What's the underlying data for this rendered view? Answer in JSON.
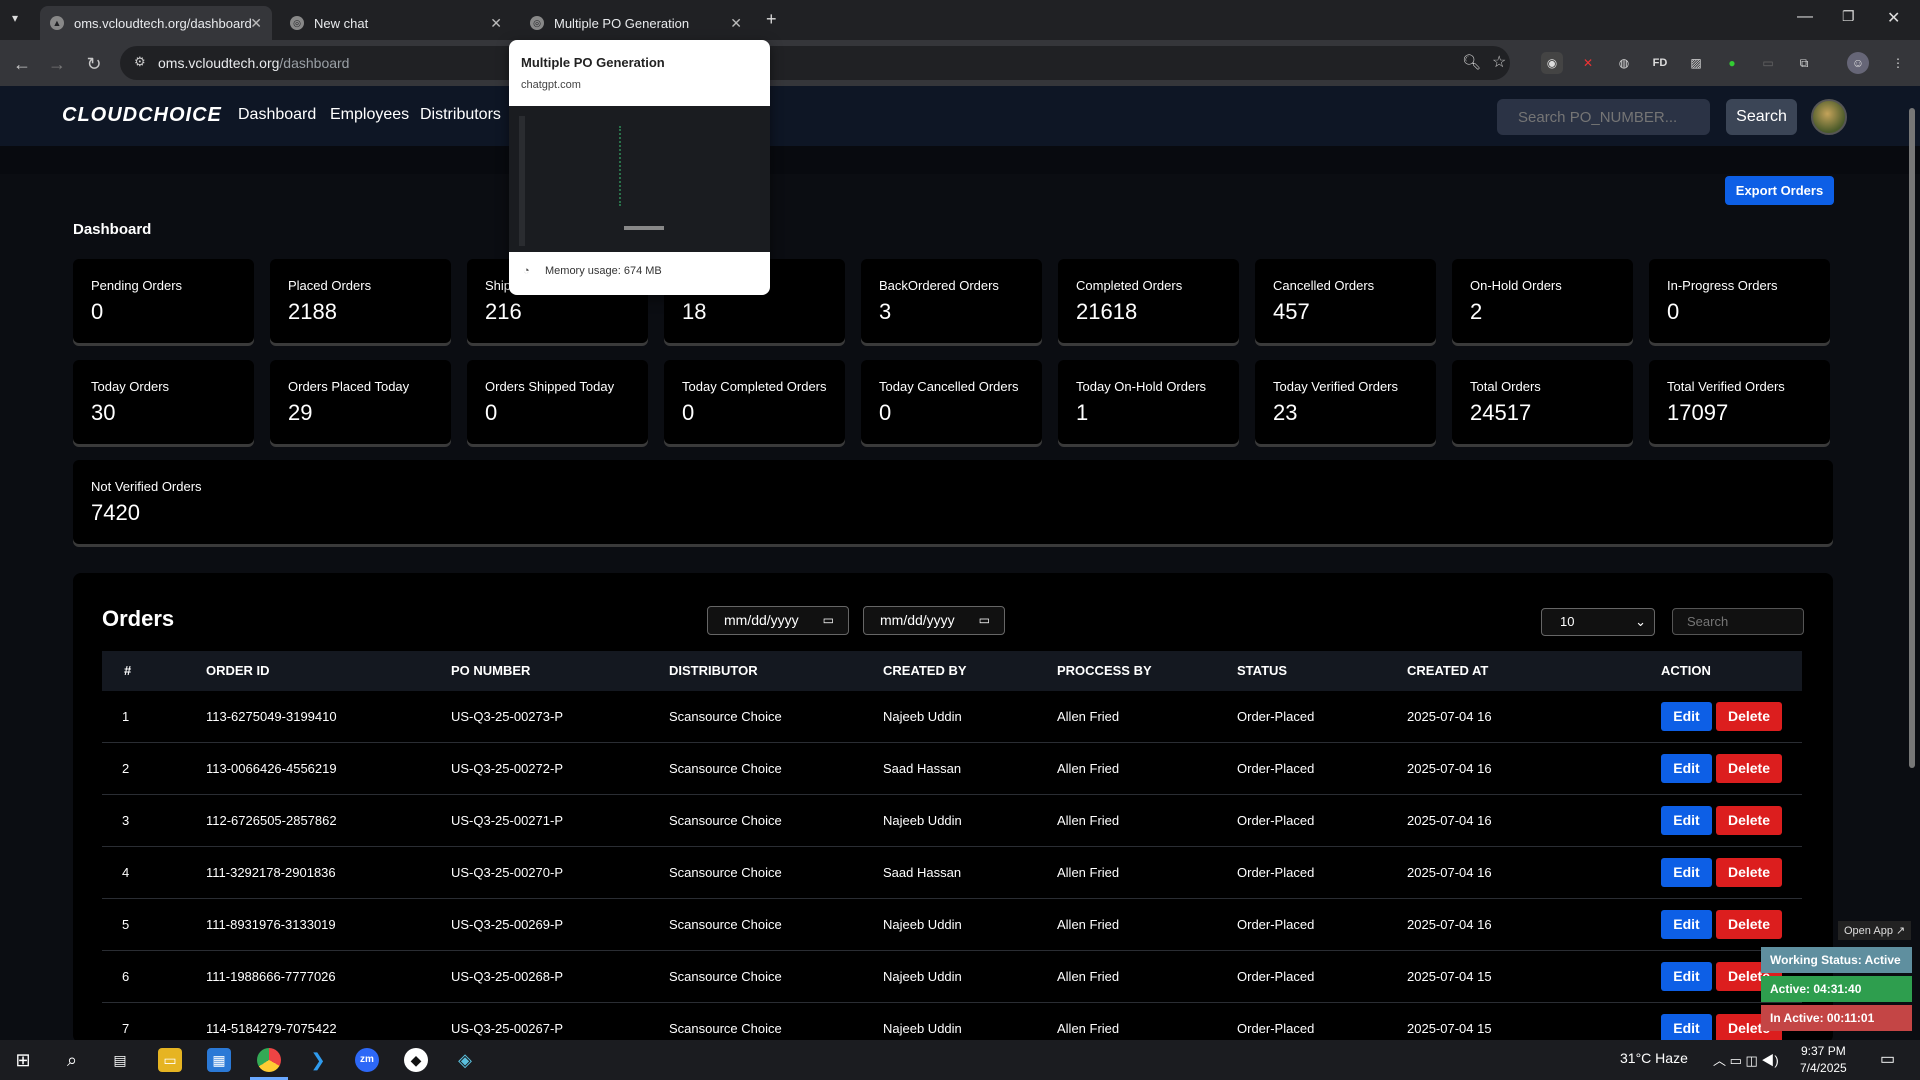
{
  "browser": {
    "tabs": [
      {
        "title": "oms.vcloudtech.org/dashboard"
      },
      {
        "title": "New chat"
      },
      {
        "title": "Multiple PO Generation"
      }
    ],
    "url_host": "oms.vcloudtech.org",
    "url_path": "/dashboard",
    "hover_card": {
      "title": "Multiple PO Generation",
      "domain": "chatgpt.com",
      "memory": "Memory usage: 674 MB"
    }
  },
  "app": {
    "logo": "CLOUDCHOICE",
    "nav": [
      "Dashboard",
      "Employees",
      "Distributors"
    ],
    "search_placeholder": "Search PO_NUMBER...",
    "search_button": "Search",
    "export_button": "Export Orders",
    "dashboard_title": "Dashboard"
  },
  "cards": [
    {
      "label": "Pending Orders",
      "value": "0"
    },
    {
      "label": "Placed Orders",
      "value": "2188"
    },
    {
      "label": "Ship",
      "value": "216"
    },
    {
      "label": "",
      "value": "18"
    },
    {
      "label": "BackOrdered Orders",
      "value": "3"
    },
    {
      "label": "Completed Orders",
      "value": "21618"
    },
    {
      "label": "Cancelled Orders",
      "value": "457"
    },
    {
      "label": "On-Hold Orders",
      "value": "2"
    },
    {
      "label": "In-Progress Orders",
      "value": "0"
    },
    {
      "label": "Today Orders",
      "value": "30"
    },
    {
      "label": "Orders Placed Today",
      "value": "29"
    },
    {
      "label": "Orders Shipped Today",
      "value": "0"
    },
    {
      "label": "Today Completed Orders",
      "value": "0"
    },
    {
      "label": "Today Cancelled Orders",
      "value": "0"
    },
    {
      "label": "Today On-Hold Orders",
      "value": "1"
    },
    {
      "label": "Today Verified Orders",
      "value": "23"
    },
    {
      "label": "Total Orders",
      "value": "24517"
    },
    {
      "label": "Total Verified Orders",
      "value": "17097"
    }
  ],
  "not_verified": {
    "label": "Not Verified Orders",
    "value": "7420"
  },
  "orders": {
    "title": "Orders",
    "date_from": "mm/dd/yyyy",
    "date_to": "mm/dd/yyyy",
    "page_size": "10",
    "search_placeholder": "Search",
    "columns": [
      "#",
      "ORDER ID",
      "PO NUMBER",
      "DISTRIBUTOR",
      "CREATED BY",
      "PROCCESS BY",
      "STATUS",
      "CREATED AT",
      "ACTION"
    ],
    "edit_label": "Edit",
    "delete_label": "Delete",
    "rows": [
      [
        "1",
        "113-6275049-3199410",
        "US-Q3-25-00273-P",
        "Scansource Choice",
        "Najeeb Uddin",
        "Allen Fried",
        "Order-Placed",
        "2025-07-04 16"
      ],
      [
        "2",
        "113-0066426-4556219",
        "US-Q3-25-00272-P",
        "Scansource Choice",
        "Saad Hassan",
        "Allen Fried",
        "Order-Placed",
        "2025-07-04 16"
      ],
      [
        "3",
        "112-6726505-2857862",
        "US-Q3-25-00271-P",
        "Scansource Choice",
        "Najeeb Uddin",
        "Allen Fried",
        "Order-Placed",
        "2025-07-04 16"
      ],
      [
        "4",
        "111-3292178-2901836",
        "US-Q3-25-00270-P",
        "Scansource Choice",
        "Saad Hassan",
        "Allen Fried",
        "Order-Placed",
        "2025-07-04 16"
      ],
      [
        "5",
        "111-8931976-3133019",
        "US-Q3-25-00269-P",
        "Scansource Choice",
        "Najeeb Uddin",
        "Allen Fried",
        "Order-Placed",
        "2025-07-04 16"
      ],
      [
        "6",
        "111-1988666-7777026",
        "US-Q3-25-00268-P",
        "Scansource Choice",
        "Najeeb Uddin",
        "Allen Fried",
        "Order-Placed",
        "2025-07-04 15"
      ],
      [
        "7",
        "114-5184279-7075422",
        "US-Q3-25-00267-P",
        "Scansource Choice",
        "Najeeb Uddin",
        "Allen Fried",
        "Order-Placed",
        "2025-07-04 15"
      ]
    ]
  },
  "widget": {
    "open_app": "Open App ↗",
    "working": "Working Status: Active",
    "active": "Active: 04:31:40",
    "inactive": "In Active: 00:11:01"
  },
  "taskbar": {
    "weather": "31°C  Haze",
    "time": "9:37 PM",
    "date": "7/4/2025"
  }
}
